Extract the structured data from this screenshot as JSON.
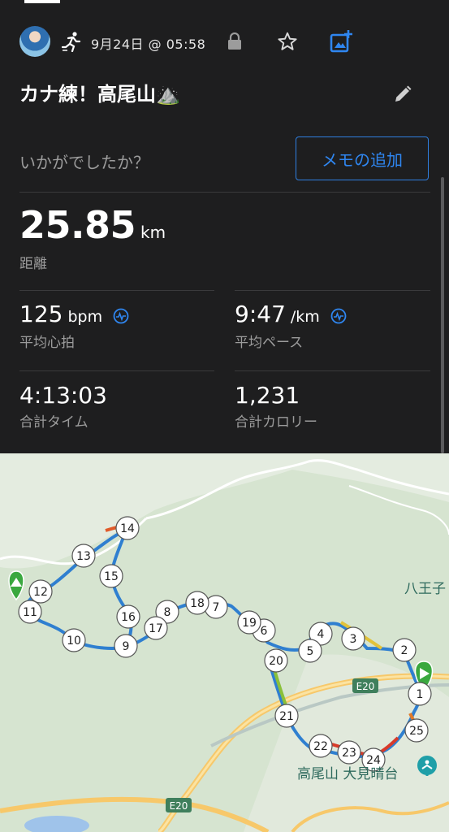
{
  "activity": {
    "date": "9月24日 @ 05:58",
    "title": "カナ練！高尾山⛰️",
    "note_prompt": "いかがでしたか？",
    "memo_button": "メモの追加"
  },
  "stats": {
    "distance": {
      "value": "25.85",
      "unit": "km",
      "label": "距離"
    },
    "avg_hr": {
      "value": "125",
      "unit": "bpm",
      "label": "平均心拍"
    },
    "avg_pace": {
      "value": "9:47",
      "unit": "/km",
      "label": "平均ペース"
    },
    "total_time": {
      "value": "4:13:03",
      "label": "合計タイム"
    },
    "calories": {
      "value": "1,231",
      "label": "合計カロリー"
    }
  },
  "map": {
    "labels": {
      "hachioji": "八王子",
      "takaosan": "高尾山 大見晴台",
      "road_e20_a": "E20",
      "road_e20_b": "E20"
    },
    "markers": [
      "1",
      "2",
      "3",
      "4",
      "5",
      "6",
      "7",
      "8",
      "9",
      "10",
      "11",
      "12",
      "13",
      "14",
      "15",
      "16",
      "17",
      "18",
      "19",
      "20",
      "21",
      "22",
      "23",
      "24",
      "25"
    ]
  },
  "colors": {
    "accent_blue": "#2f86f0",
    "start_green": "#3aa83f",
    "background": "#1e1e1f"
  },
  "icons": [
    "avatar",
    "run-icon",
    "lock-icon",
    "star-icon",
    "add-photo-icon",
    "pencil-icon",
    "heart-rate-icon",
    "mountain-emoji",
    "start-flag-icon",
    "peak-icon",
    "poi-icon"
  ]
}
